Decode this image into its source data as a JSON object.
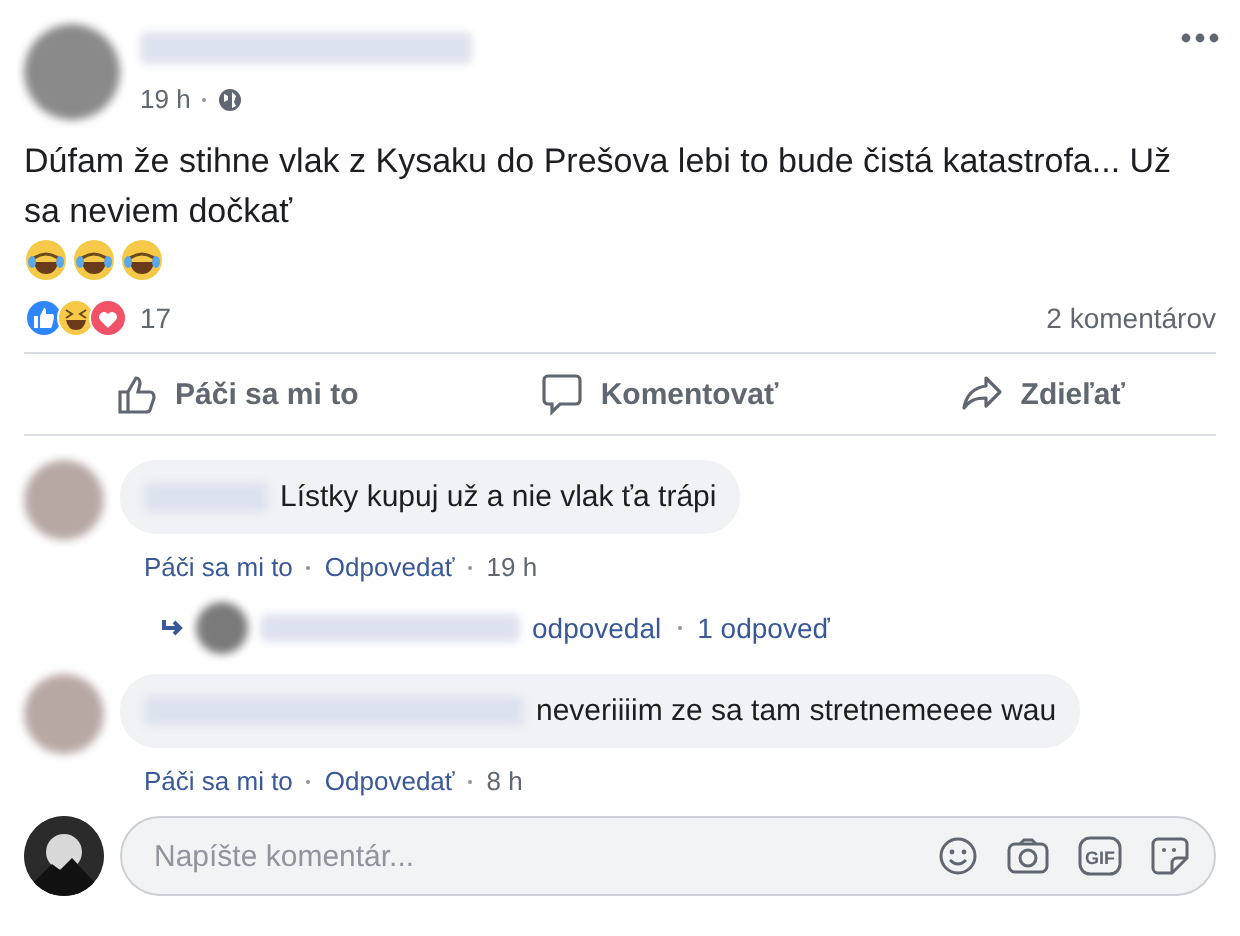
{
  "post": {
    "time": "19 h",
    "text": "Dúfam že stihne vlak z Kysaku do Prešova lebi to bude čistá katastrofa... Už sa neviem dočkať",
    "emojis": [
      {
        "kind": "laughing"
      },
      {
        "kind": "laughing"
      },
      {
        "kind": "laughing"
      }
    ]
  },
  "reactions": {
    "count": "17",
    "comments": "2 komentárov"
  },
  "actions": [
    {
      "kind": "like",
      "label": "Páči sa mi to"
    },
    {
      "kind": "comment",
      "label": "Komentovať"
    },
    {
      "kind": "share",
      "label": "Zdieľať"
    }
  ],
  "comments": [
    {
      "text": "Lístky kupuj už a nie vlak ťa trápi",
      "like": "Páči sa mi to",
      "reply": "Odpovedať",
      "time": "19 h",
      "reply_info": {
        "verb": "odpovedal",
        "count": "1 odpoveď"
      }
    },
    {
      "text": "neveriiiim ze sa tam stretnemeeee wau",
      "like": "Páči sa mi to",
      "reply": "Odpovedať",
      "time": "8 h"
    }
  ],
  "composer": {
    "placeholder": "Napíšte komentár...",
    "gif_label": "GIF"
  }
}
